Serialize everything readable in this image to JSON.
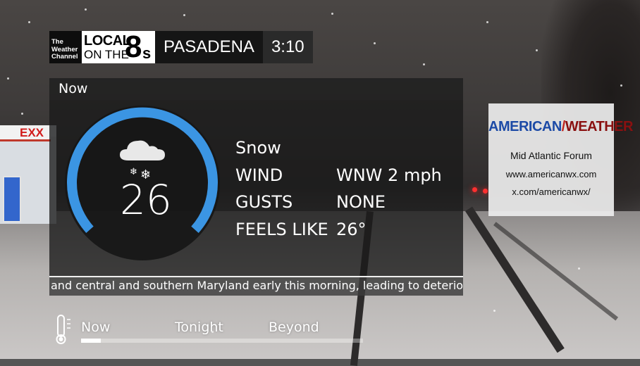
{
  "header": {
    "network_logo_text": [
      "The",
      "Weather",
      "Channel"
    ],
    "segment_logo": {
      "line1": "LOCAL",
      "line2": "ON THE",
      "numeral": "8",
      "suffix": "s"
    },
    "city": "PASADENA",
    "time": "3:10"
  },
  "current": {
    "section_title": "Now",
    "temperature": "26",
    "condition": "Snow",
    "icon": "snow-cloud-icon",
    "rows": [
      {
        "label": "WIND",
        "value": "WNW 2 mph"
      },
      {
        "label": "GUSTS",
        "value": "NONE"
      },
      {
        "label": "FEELS LIKE",
        "value": "26°"
      }
    ],
    "gauge_color": "#3b95e3"
  },
  "ticker": {
    "text": "and central and southern Maryland early this morning, leading to deterioi"
  },
  "ad": {
    "brand_left": "AMERICAN",
    "brand_right": "WEATHER",
    "lines": [
      "Mid Atlantic Forum",
      "www.americanwx.com",
      "x.com/americanwx/"
    ]
  },
  "tabs": {
    "icon": "thermometer-icon",
    "items": [
      "Now",
      "Tonight",
      "Beyond"
    ],
    "active": "Now"
  },
  "background": {
    "station_sign": "EXX"
  }
}
